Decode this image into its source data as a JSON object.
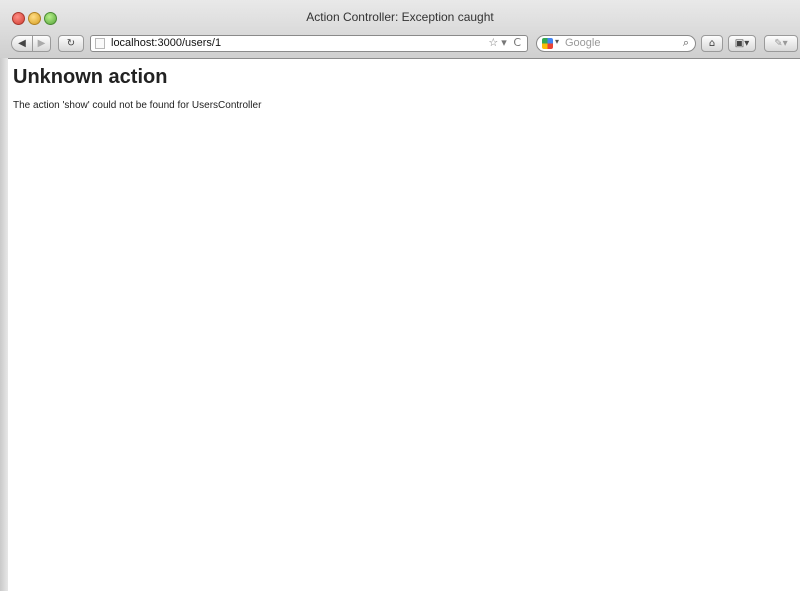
{
  "window": {
    "title": "Action Controller: Exception caught"
  },
  "toolbar": {
    "back_glyph": "◀",
    "forward_glyph": "▶",
    "reload_glyph": "↻",
    "url": "localhost:3000/users/1",
    "bookmark_star_glyph": "☆",
    "dropdown_glyph": "▾",
    "refresh_glyph": "C",
    "search_engine_caret": "▾",
    "search_placeholder": "Google",
    "search_glyph": "⌕",
    "home_glyph": "⌂",
    "bookmarks_glyph": "▣▾",
    "extra_glyph": "✎▾"
  },
  "page": {
    "heading": "Unknown action",
    "message": "The action 'show' could not be found for UsersController"
  },
  "colors": {
    "close": "#d03b30",
    "minimize": "#d69e22",
    "zoom": "#56a43a"
  }
}
